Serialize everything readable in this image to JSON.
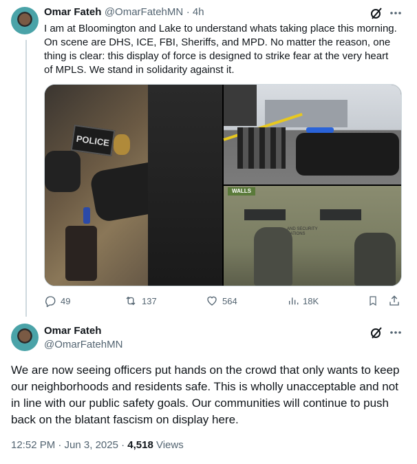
{
  "tweet1": {
    "author_name": "Omar Fateh",
    "handle": "@OmarFatehMN",
    "time": "· 4h",
    "text": "I am at Bloomington and Lake to understand whats taking place this morning. On scene are DHS, ICE, FBI, Sheriffs, and MPD. No matter the reason, one thing is clear: this display of force is designed to strike fear at the very heart of MPLS. We stand in solidarity against it.",
    "image_texts": {
      "police_patch": "POLICE",
      "vehicle_sign": "WALLS",
      "vehicle_label": "AND SECURITY\nGATIONS"
    },
    "actions": {
      "replies": "49",
      "reposts": "137",
      "likes": "564",
      "views": "18K"
    }
  },
  "tweet2": {
    "author_name": "Omar Fateh",
    "handle": "@OmarFatehMN",
    "text": "We are now seeing officers put hands on the crowd that only wants to keep our neighborhoods and residents safe. This is wholly unacceptable and not in line with our public safety goals. Our communities will continue to push back on the blatant fascism on display here.",
    "timestamp": "12:52 PM · Jun 3, 2025 · ",
    "views_count": "4,518",
    "views_label": " Views"
  },
  "icons": {
    "grok": "grok-slash-icon",
    "more": "more-dots-icon",
    "reply": "reply-bubble-icon",
    "repost": "repost-arrows-icon",
    "like": "heart-icon",
    "views": "views-bar-icon",
    "bookmark": "bookmark-icon",
    "share": "share-icon"
  },
  "colors": {
    "text": "#0f1419",
    "secondary": "#536471",
    "border": "#cfd9de"
  }
}
